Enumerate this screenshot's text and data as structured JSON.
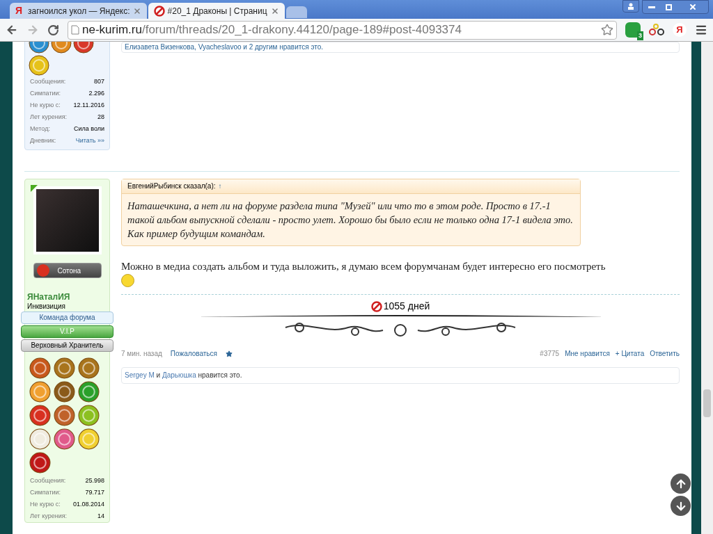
{
  "browser": {
    "tabs": [
      {
        "title": "загноился укол — Яндекс:",
        "logo": "Я",
        "selected": false
      },
      {
        "title": "#20_1 Драконы | Страниц",
        "selected": true
      }
    ],
    "yandex_button": "Я",
    "url": {
      "host": "ne-kurim.ru",
      "path": "/forum/threads/20_1-drakony.44120/page-189#post-4093374"
    },
    "extension_badge": "3"
  },
  "previous_post": {
    "likes": "Елизавета Визенкова, Vyacheslavoo и 2 другим нравится это.",
    "medals": [
      {
        "color": "#2a8fd0"
      },
      {
        "color": "#e08a1e"
      },
      {
        "color": "#d8382a"
      },
      {
        "color": "#e6c21a"
      }
    ],
    "stats": [
      {
        "label": "Сообщения:",
        "value": "807",
        "kind": "text"
      },
      {
        "label": "Симпатии:",
        "value": "2.296",
        "kind": "text"
      },
      {
        "label": "Не курю с:",
        "value": "12.11.2016",
        "kind": "text"
      },
      {
        "label": "Лет курения:",
        "value": "28",
        "kind": "text"
      },
      {
        "label": "Метод:",
        "value": "Сила воли",
        "kind": "text"
      },
      {
        "label": "Дневник:",
        "value": "Читать »»",
        "kind": "link"
      }
    ]
  },
  "post": {
    "user": {
      "rank": "Сотона",
      "name": "ЯНаталИЯ",
      "title": "Инквизиция",
      "online": true,
      "banners": [
        {
          "text": "Команда форума",
          "kind": "staff"
        },
        {
          "text": "V.I.P",
          "kind": "vip"
        },
        {
          "text": "Верховный Хранитель",
          "kind": "keeper"
        }
      ],
      "medals": [
        {
          "color": "#c8581c"
        },
        {
          "color": "#a8741c"
        },
        {
          "color": "#a8741c"
        },
        {
          "color": "#f0a030"
        },
        {
          "color": "#8a5a1a"
        },
        {
          "color": "#2aa02a"
        },
        {
          "color": "#d83020"
        },
        {
          "color": "#c0622a"
        },
        {
          "color": "#8cc020"
        },
        {
          "color": "#f0ece0"
        },
        {
          "color": "#e05a8a"
        },
        {
          "color": "#f0d030"
        },
        {
          "color": "#c01818"
        }
      ],
      "stats": [
        {
          "label": "Сообщения:",
          "value": "25.998"
        },
        {
          "label": "Симпатии:",
          "value": "79.717"
        },
        {
          "label": "Не курю с:",
          "value": "01.08.2014"
        },
        {
          "label": "Лет курения:",
          "value": "14"
        }
      ]
    },
    "quote": {
      "author": "ЕвгенийРыбинск сказал(а):",
      "jump": "↑",
      "text": "Наташечкина, а нет ли на форуме раздела типа \"Музей\" или что то в этом роде. Просто в 17.-1 такой альбом выпускной сделали - просто улет. Хорошо бы было если не только одна 17-1 видела это. Как пример будущим командам."
    },
    "message": "Можно в медиа создать альбом и туда выложить, я думаю всем форумчанам будет интересно его посмотреть",
    "signature": "1055 дней",
    "time": "7 мин. назад",
    "report": "Пожаловаться",
    "number": "#3775",
    "actions": [
      "Мне нравится",
      "+ Цитата",
      "Ответить"
    ],
    "likes": {
      "users": [
        "Sergey M",
        "Дарьюшка"
      ],
      "joiner": "и",
      "suffix": "нравится это."
    }
  }
}
